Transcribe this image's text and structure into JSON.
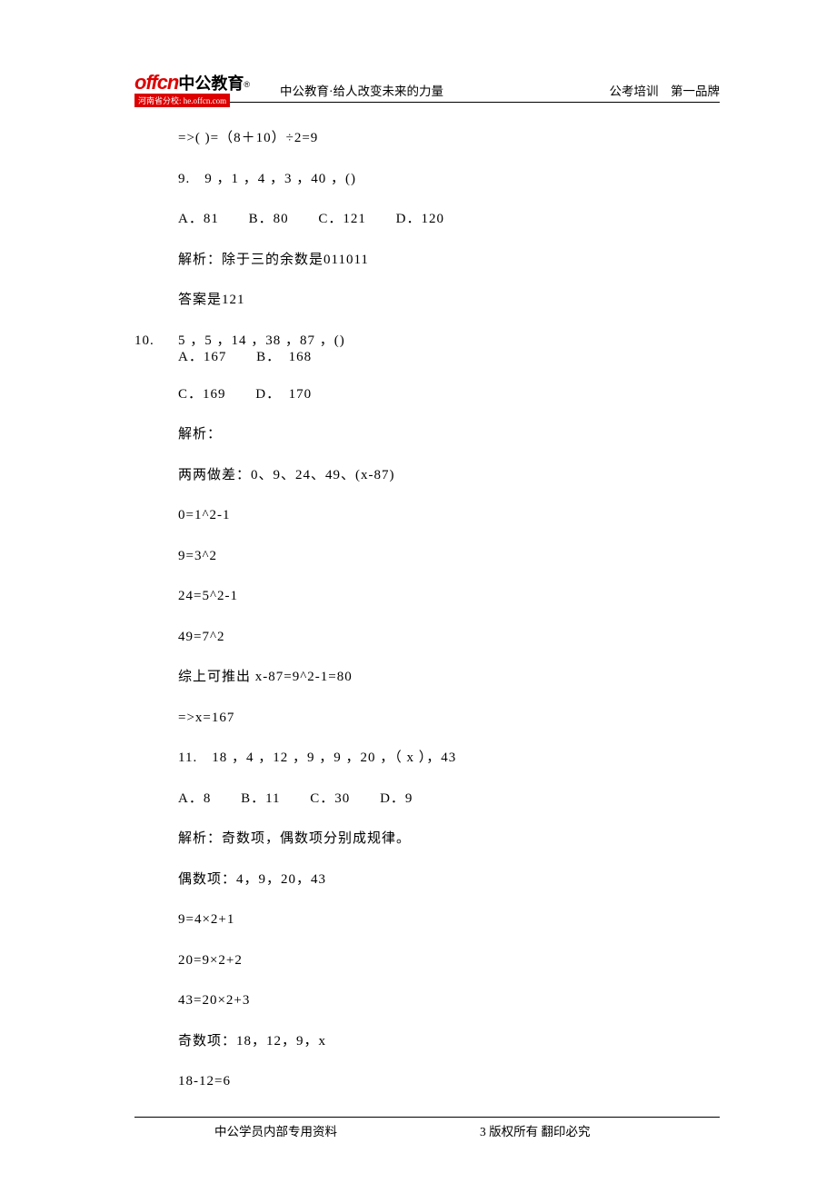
{
  "header": {
    "logo_en": "offcn",
    "logo_cn": "中公教育",
    "logo_sub": "®",
    "logo_url": "河南省分校: he.offcn.com",
    "tagline": "中公教育·给人改变未来的力量",
    "right": "公考培训　第一品牌"
  },
  "lines": {
    "l01": "=>( )=（8＋10）÷2=9",
    "q9": "9.　9 ，1 ，4 ，3 ，40 ，()",
    "q9_opts": {
      "a": "A．81",
      "b": "B．80",
      "c": "C．121",
      "d": "D．120"
    },
    "q9_exp1": "解析：除于三的余数是011011",
    "q9_ans": "答案是121",
    "q10_num": "10.",
    "q10_seq": "5 ，5 ，14 ，38 ，87 ，()",
    "q10_opts_ab": {
      "a": "A．167",
      "b": "B．　168"
    },
    "q10_opts_cd": {
      "c": "C．169",
      "d": "D．　170"
    },
    "q10_exp": "解析：",
    "q10_diff": "两两做差：0、9、24、49、(x-87)",
    "q10_c1": "0=1^2-1",
    "q10_c2": "9=3^2",
    "q10_c3": "24=5^2-1",
    "q10_c4": "49=7^2",
    "q10_conc": "综上可推出 x-87=9^2-1=80",
    "q10_res": "=>x=167",
    "q11": "11.　18 ，4 ，12 ，9 ，9 ，20 ，（ x ），43",
    "q11_opts": {
      "a": "A．8",
      "b": "B．11",
      "c": "C．30",
      "d": "D．9"
    },
    "q11_exp1": "解析：奇数项，偶数项分别成规律。",
    "q11_even": "偶数项：4，9，20，43",
    "q11_e1": "9=4×2+1",
    "q11_e2": "20=9×2+2",
    "q11_e3": "43=20×2+3",
    "q11_odd": "奇数项：18，12，9，x",
    "q11_o1": "18-12=6"
  },
  "footer": {
    "left": "中公学员内部专用资料",
    "right": "3 版权所有 翻印必究"
  }
}
